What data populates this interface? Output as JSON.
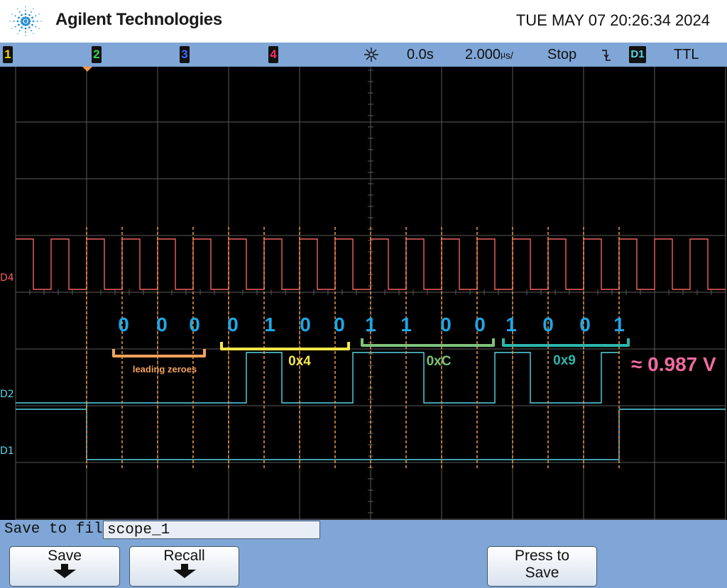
{
  "header": {
    "brand": "Agilent Technologies",
    "datetime": "TUE MAY 07 20:26:34 2024"
  },
  "statusbar": {
    "channels": [
      {
        "label": "1",
        "color": "#f5d200"
      },
      {
        "label": "2",
        "color": "#38d54a"
      },
      {
        "label": "3",
        "color": "#3a6cff"
      },
      {
        "label": "4",
        "color": "#ff2a6a"
      }
    ],
    "acquire_icon": "acquire-star-icon",
    "delay": "0.0s",
    "timebase": "2.000",
    "timebase_unit": "s/",
    "timebase_unit_prefix": "µ",
    "run_state": "Stop",
    "trigger_slope_icon": "falling-edge-icon",
    "trigger_source": "D1",
    "trigger_level": "TTL"
  },
  "screen": {
    "channel_labels": [
      "D4",
      "D2",
      "D1"
    ],
    "bits": [
      "0",
      "0",
      "0",
      "0",
      "1",
      "0",
      "0",
      "1",
      "1",
      "0",
      "0",
      "1",
      "0",
      "0",
      "1"
    ],
    "bits_color": "#1fa7e6",
    "groups": [
      {
        "label": "leading zeroes",
        "color": "#f4a25a"
      },
      {
        "label": "0x4",
        "color": "#f7e64a"
      },
      {
        "label": "0xC",
        "color": "#7ec27a"
      },
      {
        "label": "0x9",
        "color": "#2bb7ad"
      }
    ],
    "voltage": "≈ 0.987 V",
    "voltage_color": "#f06aa0",
    "clock_color": "#f06060",
    "data_color": "#58d6e6",
    "sample_marker_color": "#f29a45",
    "trigger_marker_color": "#f29a45",
    "grid_color": "#5a5a5a"
  },
  "bottom": {
    "save_to_file_label": "Save to file =",
    "filename": "scope_1",
    "softkeys": [
      {
        "label": "Save",
        "has_arrow": true
      },
      {
        "label": "Recall",
        "has_arrow": true
      },
      {
        "label": "Press to Save",
        "line1": "Press to",
        "line2": "Save",
        "has_arrow": false
      }
    ]
  }
}
